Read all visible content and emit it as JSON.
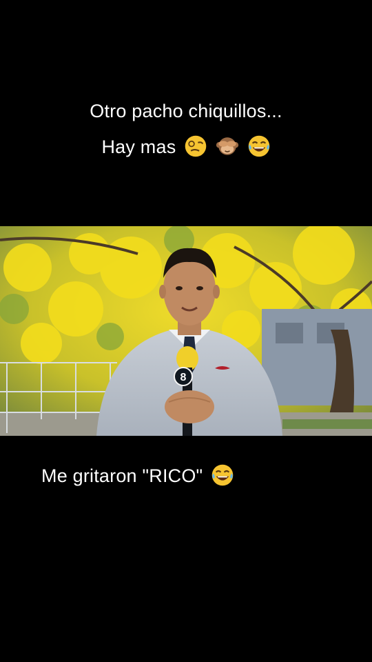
{
  "captions": {
    "top_line_1": "Otro pacho chiquillos...",
    "top_line_2": "Hay mas",
    "bottom": "Me gritaron \"RICO\""
  },
  "emojis": {
    "top": [
      "woozy-face-icon",
      "see-no-evil-monkey-icon",
      "tears-of-joy-icon"
    ],
    "bottom": [
      "tears-of-joy-icon"
    ]
  },
  "video": {
    "scene": "reporter-under-yellow-flowering-tree",
    "microphone_logo": "8"
  },
  "colors": {
    "background": "#000000",
    "text": "#ffffff",
    "foliage_yellow": "#e7d21c",
    "sweater": "#bfc6cf"
  }
}
